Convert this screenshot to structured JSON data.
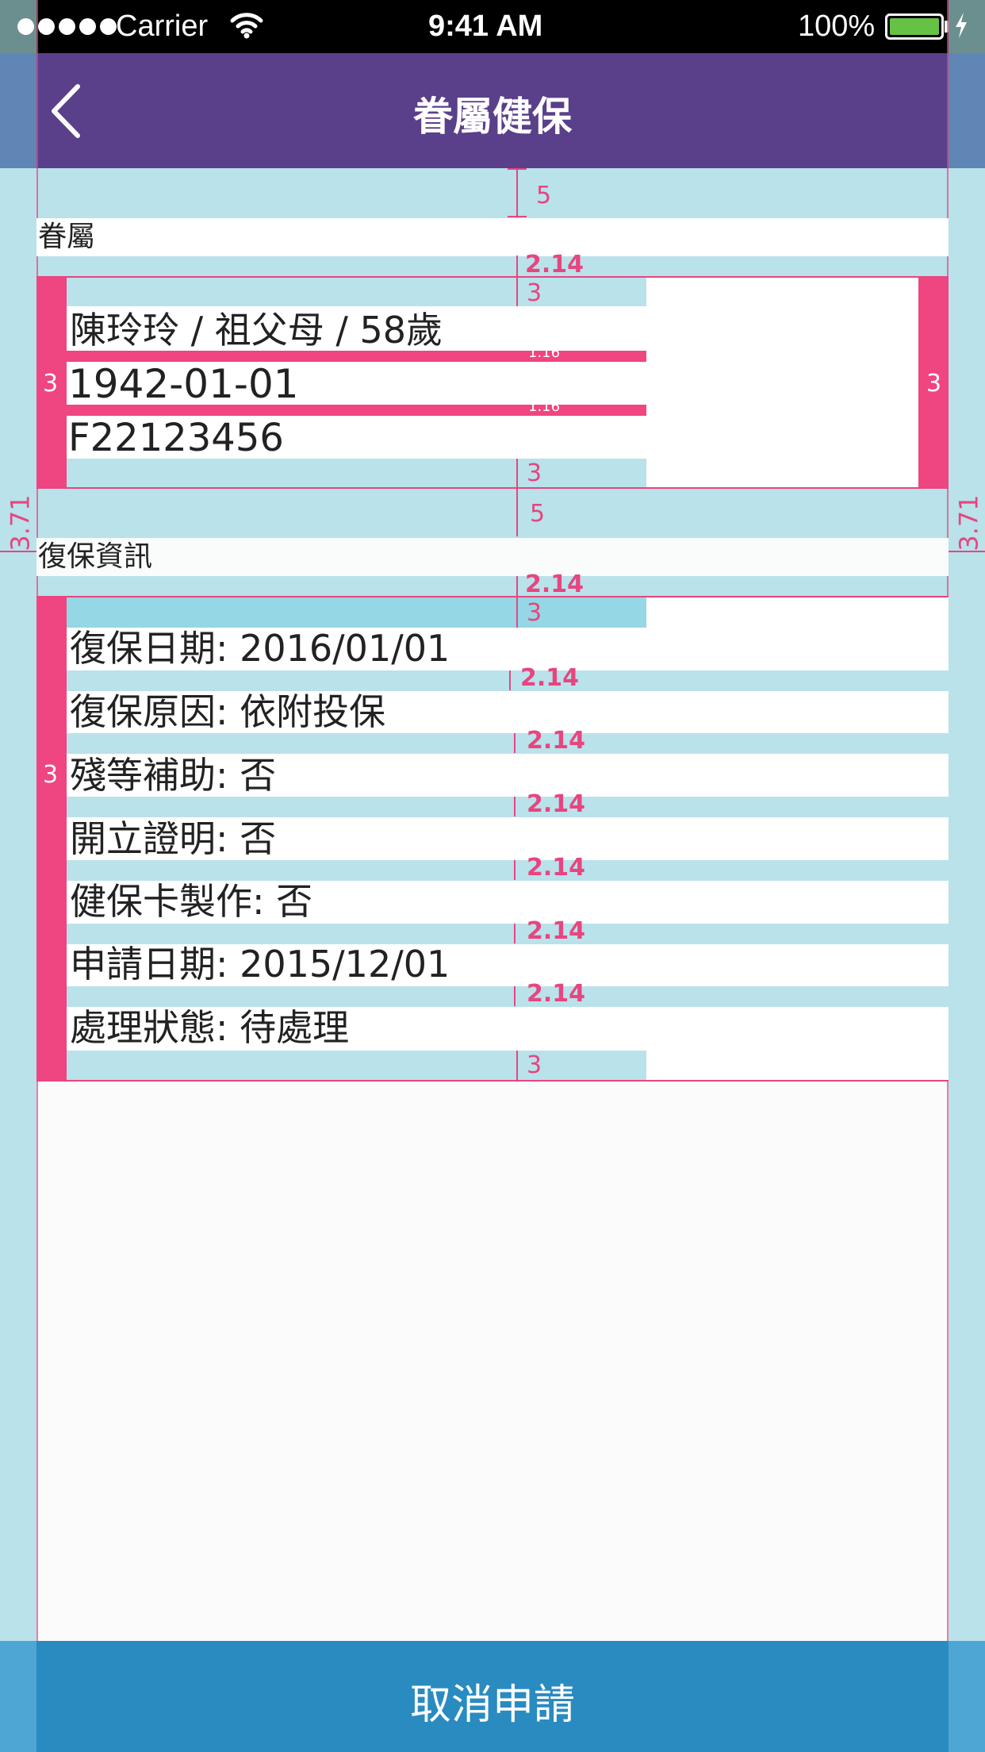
{
  "status_bar": {
    "carrier": "Carrier",
    "time": "9:41 AM",
    "battery": "100%"
  },
  "nav": {
    "title": "眷屬健保"
  },
  "dependent_section": {
    "header": "眷屬",
    "lines": [
      "陳玲玲 / 祖父母 / 58歲",
      "1942-01-01",
      "F22123456"
    ]
  },
  "reinstatement_section": {
    "header": "復保資訊",
    "rows": [
      "復保日期: 2016/01/01",
      "復保原因: 依附投保",
      "殘等補助: 否",
      "開立證明: 否",
      "健保卡製作: 否",
      "申請日期: 2015/12/01",
      "處理狀態: 待處理"
    ]
  },
  "annotations": {
    "top_gap": "5",
    "header_gap": "2.14",
    "card_pad": "3",
    "line_gap": "1.16",
    "side_margin": "3.71",
    "row_gap": "2.14"
  },
  "actions": {
    "cancel": "取消申請"
  }
}
